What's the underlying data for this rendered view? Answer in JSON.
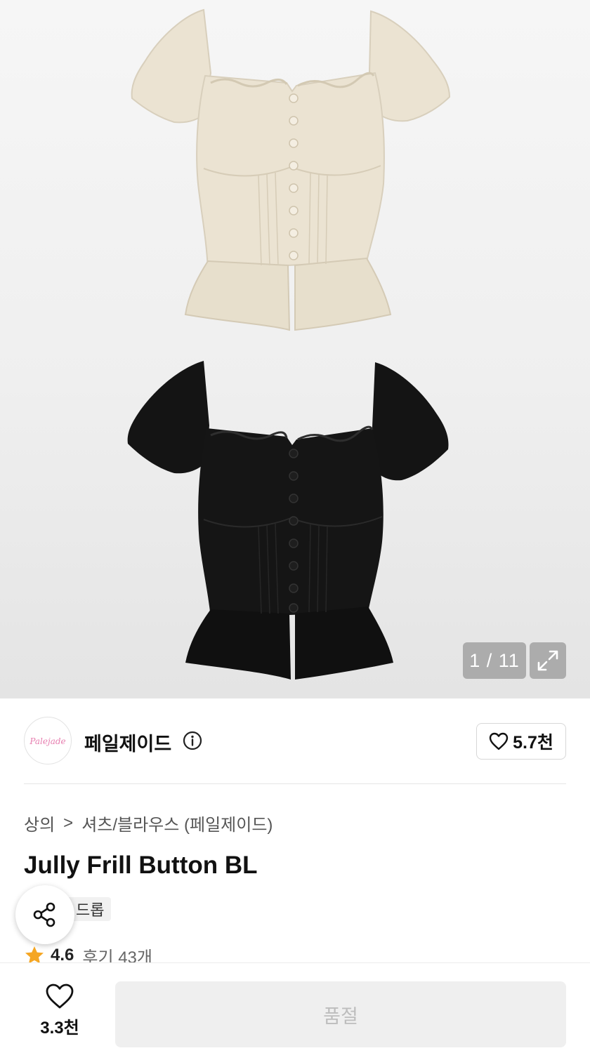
{
  "gallery": {
    "counter": "1 / 11",
    "images": [
      "cream-blouse",
      "black-blouse"
    ],
    "colors": {
      "cream": "#ebe3d2",
      "black": "#121212"
    }
  },
  "brand": {
    "logo_text": "Palejade",
    "name": "페일제이드",
    "like_count": "5.7천"
  },
  "breadcrumb": {
    "category": "상의",
    "separator": ">",
    "subcategory": "셔츠/블라우스 (페일제이드)"
  },
  "product": {
    "title": "Jully Frill Button BL",
    "tag": "드롭"
  },
  "rating": {
    "value": "4.6",
    "reviews": "후기 43개",
    "star_color": "#f5a623"
  },
  "bottom": {
    "wish_count": "3.3천",
    "buy_label": "품절"
  }
}
